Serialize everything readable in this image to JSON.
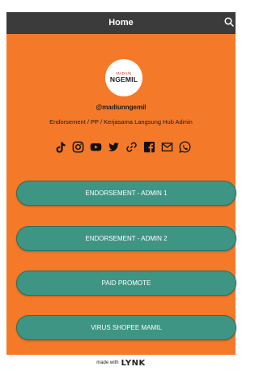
{
  "header": {
    "title": "Home",
    "search_icon": "search-icon"
  },
  "profile": {
    "logo_small": "MADIUN",
    "logo_main": "NGEMIL",
    "handle": "@madiunngemil",
    "bio": "Endorsement / PP / Kerjasama Langsung Hub Admin"
  },
  "socials": [
    "tiktok-icon",
    "instagram-icon",
    "youtube-icon",
    "twitter-icon",
    "link-icon",
    "facebook-icon",
    "email-icon",
    "whatsapp-icon"
  ],
  "buttons": [
    "ENDORSEMENT - ADMIN 1",
    "ENDORSEMENT - ADMIN 2",
    "PAID PROMOTE",
    "VIRUS SHOPEE MAMIL"
  ],
  "footer": {
    "text": "made with",
    "brand": "LYNK"
  },
  "colors": {
    "background": "#f47a2a",
    "button": "#3f9583",
    "button_border": "#2b6f60",
    "topbar": "#3b3b3b"
  }
}
